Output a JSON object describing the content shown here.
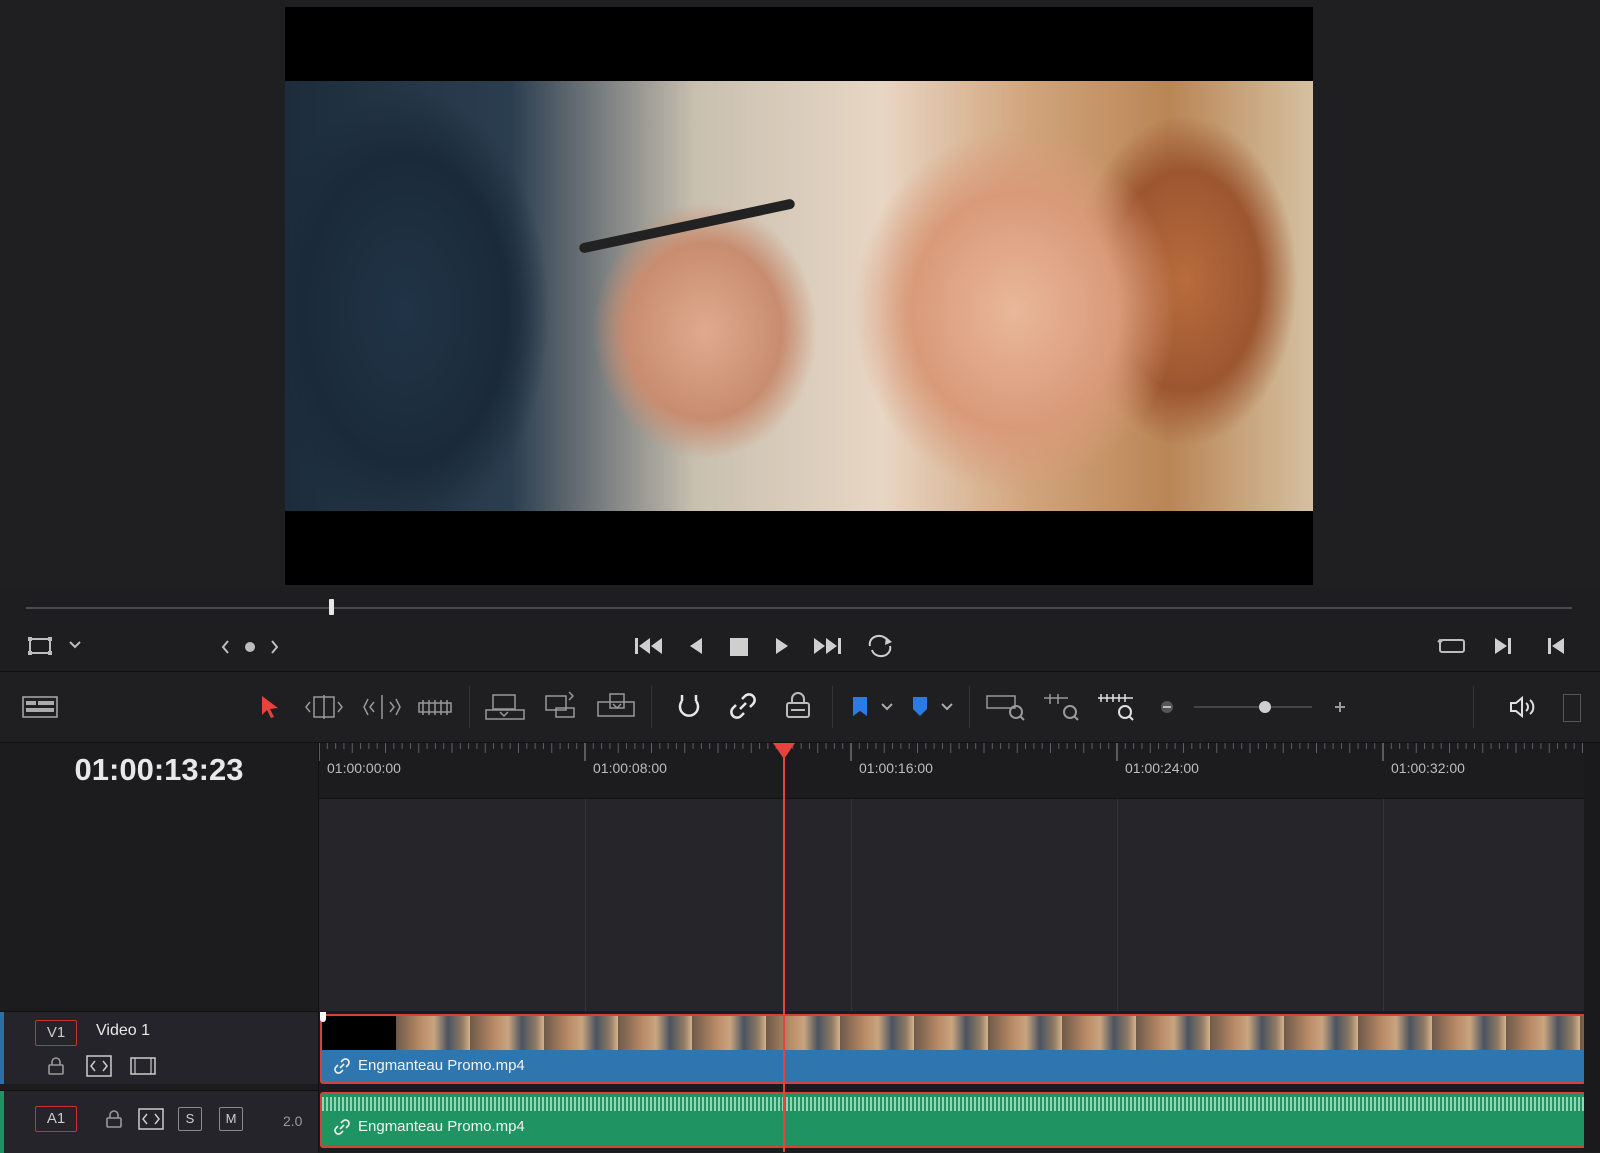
{
  "viewer": {
    "image_description": "video frame"
  },
  "transport": {
    "icons": [
      "go-to-start-icon",
      "step-back-icon",
      "stop-icon",
      "play-icon",
      "go-to-end-icon",
      "loop-icon"
    ]
  },
  "toolbar": {
    "icons": [
      "timeline-view-icon",
      "selection-arrow-icon",
      "trim-edit-icon",
      "dynamic-trim-icon",
      "blade-icon",
      "insert-clip-icon",
      "overwrite-clip-icon",
      "replace-clip-icon",
      "snapping-icon",
      "linked-selection-icon",
      "position-lock-icon",
      "flag-icon",
      "marker-icon",
      "zoom-full-icon",
      "zoom-detail-icon",
      "zoom-custom-icon",
      "zoom-out-icon",
      "zoom-in-icon",
      "audio-icon"
    ],
    "zoom_level": 0.6
  },
  "timeline": {
    "timecode": "01:00:13:23",
    "ruler_labels": [
      "01:00:00:00",
      "01:00:08:00",
      "01:00:16:00",
      "01:00:24:00",
      "01:00:32:00"
    ],
    "tracks": {
      "v1": {
        "tag": "V1",
        "name": "Video 1",
        "clip_name": "Engmanteau Promo.mp4"
      },
      "a1": {
        "tag": "A1",
        "solo": "S",
        "mute": "M",
        "channels": "2.0",
        "clip_name": "Engmanteau Promo.mp4"
      }
    }
  },
  "colors": {
    "playhead": "#e8423c",
    "video_clip": "#2e76ad",
    "audio_clip": "#1f9462",
    "clip_selection": "#d8403a"
  }
}
